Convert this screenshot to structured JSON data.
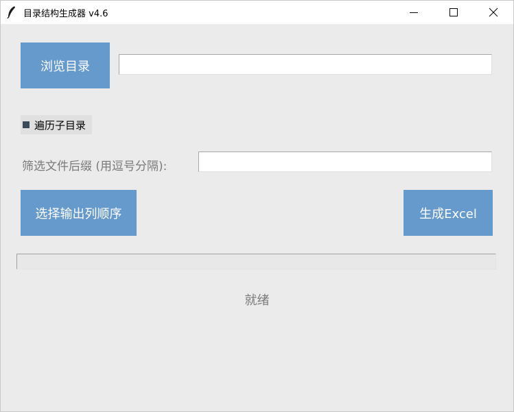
{
  "window": {
    "title": "目录结构生成器 v4.6",
    "app_icon": "feather-icon",
    "controls": [
      "minimize-icon",
      "maximize-icon",
      "close-icon"
    ]
  },
  "browse": {
    "button_label": "浏览目录",
    "path_value": ""
  },
  "recurse": {
    "label": "遍历子目录",
    "checked": false
  },
  "filter": {
    "label": "筛选文件后缀 (用逗号分隔):",
    "value": ""
  },
  "actions": {
    "order_label": "选择输出列顺序",
    "generate_label": "生成Excel"
  },
  "progress": {
    "fraction": 0
  },
  "status": {
    "text": "就绪"
  },
  "colors": {
    "button_bg": "#6699cc",
    "window_bg": "#ebebeb"
  }
}
